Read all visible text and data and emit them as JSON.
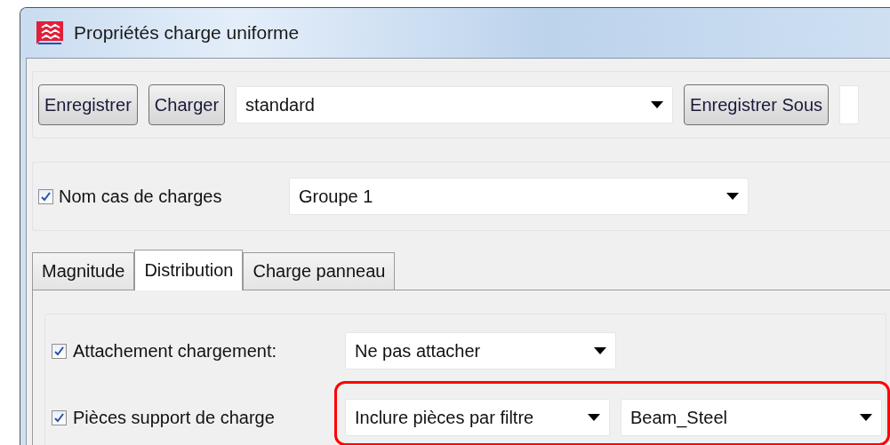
{
  "window": {
    "title": "Propriétés charge uniforme"
  },
  "toolbar": {
    "buttons": [
      "Enregistrer",
      "Charger"
    ],
    "preset": "standard",
    "save_as_button": "Enregistrer Sous"
  },
  "load_case": {
    "label": "Nom cas de charges",
    "checked": true,
    "value": "Groupe 1"
  },
  "tabs": [
    {
      "label": "Magnitude",
      "selected": false
    },
    {
      "label": "Distribution",
      "selected": true
    },
    {
      "label": "Charge panneau",
      "selected": false
    }
  ],
  "rows": [
    {
      "label": "Attachement chargement:",
      "checked": true,
      "highlighted": false,
      "dropdowns": [
        "Ne pas attacher"
      ]
    },
    {
      "label": "Pièces support de charge",
      "checked": true,
      "highlighted": true,
      "dropdowns": [
        "Inclure pièces par filtre",
        "Beam_Steel"
      ]
    }
  ]
}
